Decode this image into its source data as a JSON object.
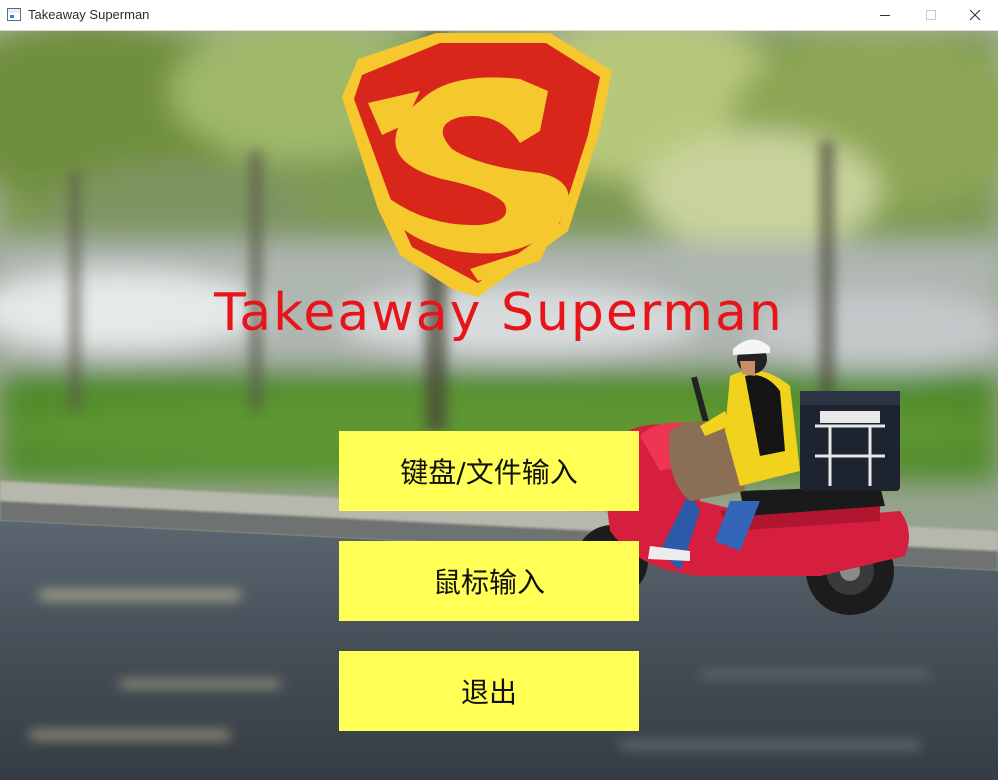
{
  "window": {
    "title": "Takeaway Superman"
  },
  "app": {
    "title": "Takeaway Superman",
    "logo_icon": "superman-shield-logo",
    "colors": {
      "title_text": "#e8141a",
      "button_bg": "#ffff55",
      "logo_yellow": "#f5c32c",
      "logo_red": "#d42718"
    }
  },
  "menu": {
    "buttons": [
      {
        "label": "键盘/文件输入"
      },
      {
        "label": "鼠标输入"
      },
      {
        "label": "退出"
      }
    ]
  },
  "background": {
    "description_icon": "delivery-rider-photo"
  }
}
